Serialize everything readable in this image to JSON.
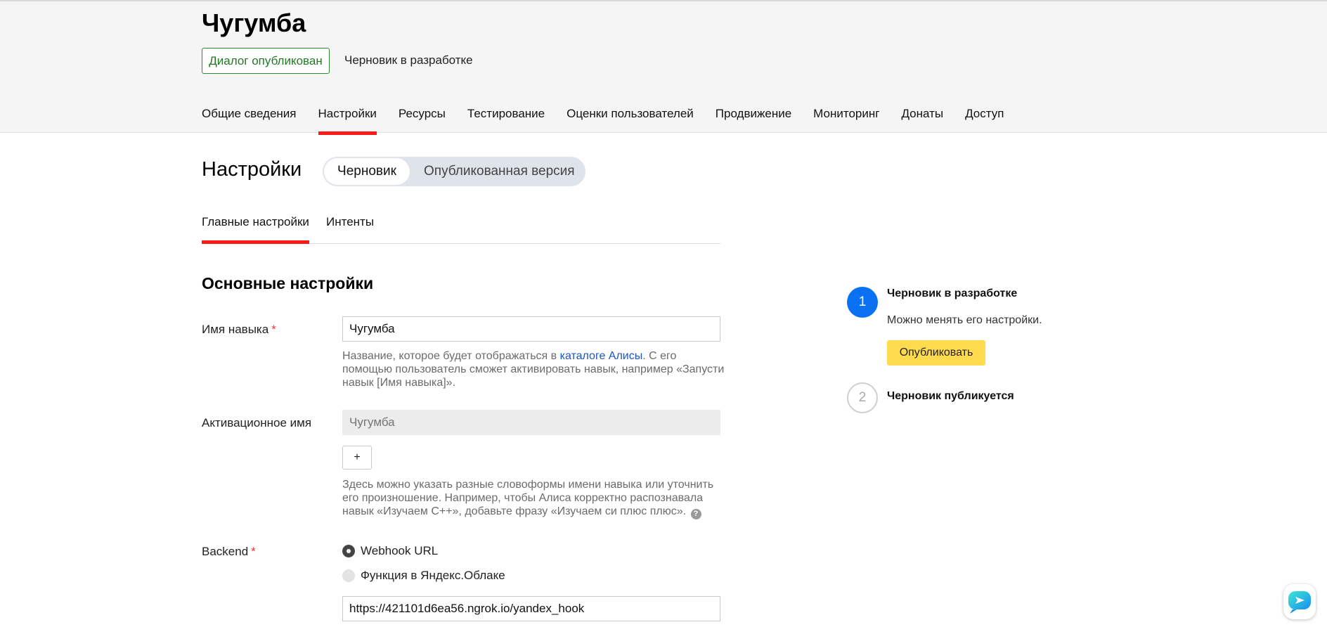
{
  "header": {
    "skill_name": "Чугумба",
    "published_badge": "Диалог опубликован",
    "draft_status": "Черновик в разработке"
  },
  "nav": {
    "tabs": [
      {
        "label": "Общие сведения",
        "active": false
      },
      {
        "label": "Настройки",
        "active": true
      },
      {
        "label": "Ресурсы",
        "active": false
      },
      {
        "label": "Тестирование",
        "active": false
      },
      {
        "label": "Оценки пользователей",
        "active": false
      },
      {
        "label": "Продвижение",
        "active": false
      },
      {
        "label": "Мониторинг",
        "active": false
      },
      {
        "label": "Донаты",
        "active": false
      },
      {
        "label": "Доступ",
        "active": false
      }
    ]
  },
  "settings": {
    "title": "Настройки",
    "toggle": {
      "draft": "Черновик",
      "published": "Опубликованная версия"
    },
    "subtabs": {
      "main": "Главные настройки",
      "intents": "Интенты"
    },
    "section_title": "Основные настройки"
  },
  "form": {
    "skill_name": {
      "label": "Имя навыка",
      "required_mark": "*",
      "value": "Чугумба",
      "hint_before": "Название, которое будет отображаться в ",
      "hint_link": "каталоге Алисы",
      "hint_after": ". С его помощью пользователь сможет активировать навык, например «Запусти навык [Имя навыка]»."
    },
    "activation_name": {
      "label": "Активационное имя",
      "placeholder": "Чугумба",
      "add_label": "+",
      "hint": "Здесь можно указать разные словоформы имени навыка или уточнить его произношение. Например, чтобы Алиса корректно распознавала навык «Изучаем C++», добавьте фразу «Изучаем си плюс плюс».",
      "help_icon": "?"
    },
    "backend": {
      "label": "Backend",
      "required_mark": "*",
      "options": [
        "Webhook URL",
        "Функция в Яндекс.Облаке"
      ],
      "selected": 0,
      "url_value": "https://421101d6ea56.ngrok.io/yandex_hook"
    }
  },
  "steps": [
    {
      "number": "1",
      "title": "Черновик в разработке",
      "description": "Можно менять его настройки.",
      "button": "Опубликовать"
    },
    {
      "number": "2",
      "title": "Черновик публикуется"
    }
  ],
  "colors": {
    "accent_red": "#ff1a1a",
    "step_blue": "#0a72f2",
    "publish_yellow": "#ffdb4d",
    "published_green": "#237a23"
  }
}
